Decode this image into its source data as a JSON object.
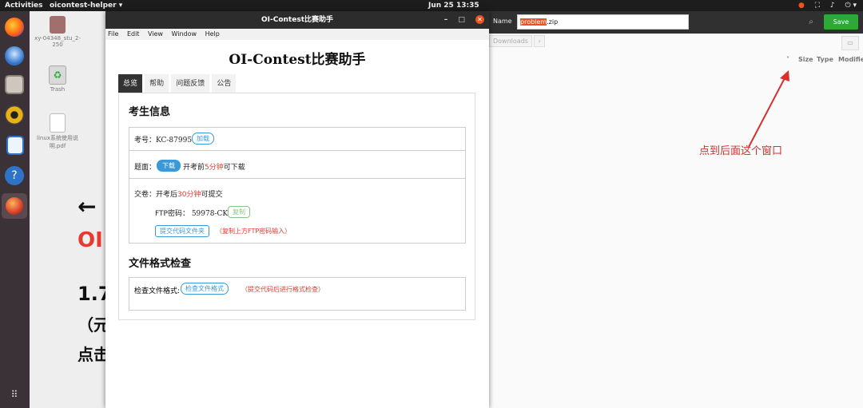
{
  "topbar": {
    "activities": "Activities",
    "app": "oicontest-helper ▾",
    "clock": "Jun 25  13:35",
    "tray_icons": [
      "app-icon",
      "network-icon",
      "volume-icon",
      "power-icon"
    ]
  },
  "desktop": {
    "items": [
      {
        "label": "xy-04348_stu_2-250",
        "icon": "home-folder-icon"
      },
      {
        "label": "Trash",
        "icon": "trash-icon"
      },
      {
        "label": "linux系统使用说明.pdf",
        "icon": "pdf-file-icon"
      }
    ],
    "bg_text": {
      "arrow": "←",
      "oi": "OI",
      "step": "1.7",
      "paren": "（元",
      "click": "点击"
    }
  },
  "dock": {
    "icons": [
      "firefox-icon",
      "thunderbird-icon",
      "files-icon",
      "rhythmbox-icon",
      "writer-icon",
      "help-icon",
      "oicontest-icon",
      "app-grid-icon"
    ]
  },
  "window": {
    "title": "OI-Contest比赛助手",
    "controls": {
      "minimize": "–",
      "maximize": "□",
      "close": "✕"
    },
    "menu": [
      "File",
      "Edit",
      "View",
      "Window",
      "Help"
    ],
    "app_title": "OI-Contest比赛助手",
    "tabs": [
      "总览",
      "帮助",
      "问题反馈",
      "公告"
    ],
    "section1": "考生信息",
    "exam_id_label": "考号：",
    "exam_id": "KC-87995",
    "load_btn": "加载",
    "problem_label": "题面：",
    "download_btn": "下载",
    "problem_note_a": "开考前",
    "problem_note_b": "5分钟",
    "problem_note_c": "可下载",
    "submit_label": "交卷：开考后",
    "submit_note_b": "30分钟",
    "submit_note_c": "可提交",
    "ftp_label": "FTP密码：",
    "ftp_value": "59978-CK",
    "copy_btn": "复制",
    "submit_folder_btn": "提交代码文件夹",
    "submit_hint": "（复制上方FTP密码输入）",
    "section2": "文件格式检查",
    "check_label": "检查文件格式:",
    "check_btn": "检查文件格式",
    "check_hint": "（提交代码后进行格式检查）"
  },
  "dialog": {
    "name_label": "Name",
    "filename_selected": "problem",
    "filename_rest": ".zip",
    "save_btn": "Save",
    "crumb": "Downloads",
    "crumb_more": "›",
    "columns": [
      "Size",
      "Type",
      "Modified"
    ],
    "sort_indicator": "˅"
  },
  "annotation": "点到后面这个窗口",
  "colors": {
    "accent": "#e95420",
    "save": "#2ea938",
    "link": "#3a9ad9",
    "annotation": "#d8302f"
  }
}
